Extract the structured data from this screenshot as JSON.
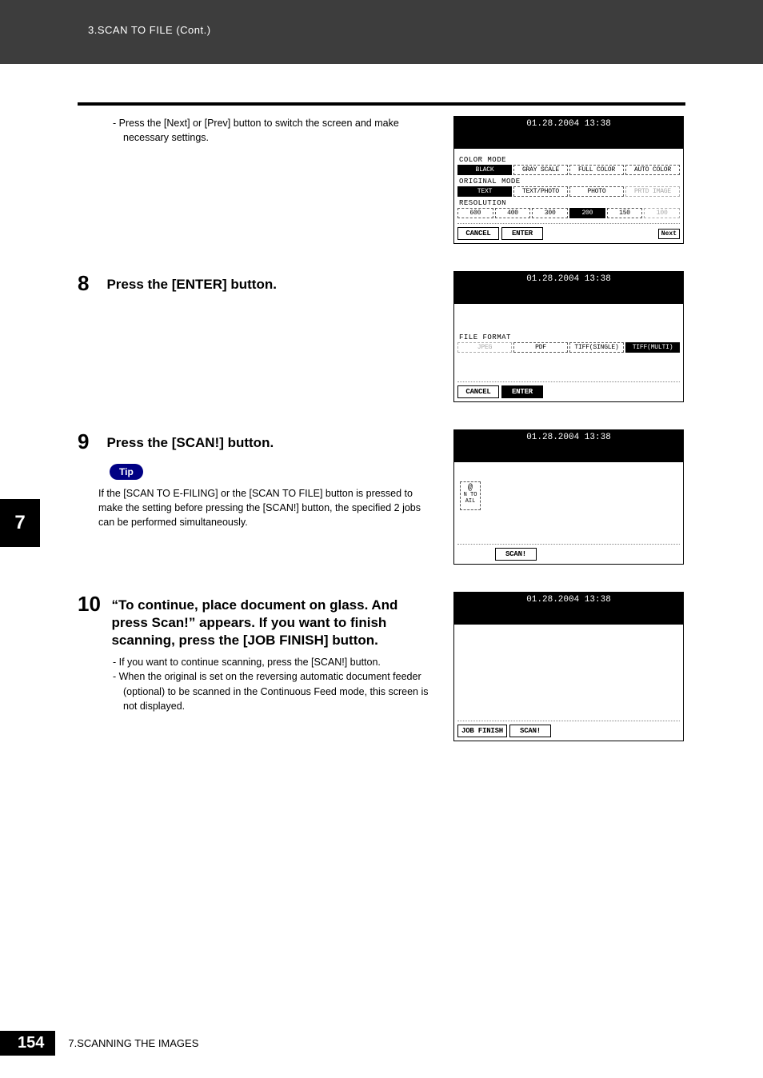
{
  "header": {
    "breadcrumb": "3.SCAN TO FILE (Cont.)"
  },
  "side_tab": "7",
  "footer": {
    "page": "154",
    "chapter": "7.SCANNING THE IMAGES"
  },
  "top_bullets": [
    "-  Press the [Next] or [Prev] button to switch the screen and make necessary settings."
  ],
  "steps": [
    {
      "num": "8",
      "title": "Press the [ENTER] button."
    },
    {
      "num": "9",
      "title": "Press the [SCAN!] button.",
      "tip_label": "Tip",
      "tip_text": "If the [SCAN TO E-FILING] or the [SCAN TO FILE] button is pressed to make the setting before pressing the [SCAN!] button, the specified 2 jobs can be performed simultaneously."
    },
    {
      "num": "10",
      "title": "“To continue, place document on glass. And press Scan!” appears. If you want to finish scanning, press the [JOB FINISH] button.",
      "bullets": [
        "-  If you want to continue scanning, press the [SCAN!] button.",
        "-  When the original is set on the reversing automatic document feeder (optional) to be scanned in the Continuous Feed mode, this screen is not displayed."
      ]
    }
  ],
  "screens": {
    "timestamp": "01.28.2004 13:38",
    "s1": {
      "color_mode_label": "COLOR MODE",
      "color_mode": {
        "opts": [
          "BLACK",
          "GRAY SCALE",
          "FULL COLOR",
          "AUTO COLOR"
        ],
        "selected": 0
      },
      "original_mode_label": "ORIGINAL MODE",
      "original_mode": {
        "opts": [
          "TEXT",
          "TEXT/PHOTO",
          "PHOTO",
          "PRTD IMAGE"
        ],
        "selected": 0,
        "disabled": [
          3
        ]
      },
      "resolution_label": "RESOLUTION",
      "resolution": {
        "opts": [
          "600",
          "400",
          "300",
          "200",
          "150",
          "100"
        ],
        "selected": 3,
        "disabled": [
          5
        ]
      },
      "cancel": "CANCEL",
      "enter": "ENTER",
      "next": "Next"
    },
    "s2": {
      "file_format_label": "FILE FORMAT",
      "file_format": {
        "opts": [
          "JPEG",
          "PDF",
          "TIFF(SINGLE)",
          "TIFF(MULTI)"
        ],
        "selected": 3,
        "disabled": [
          0
        ]
      },
      "cancel": "CANCEL",
      "enter": "ENTER"
    },
    "s3": {
      "icon_caption": "N TO\nAIL",
      "scan": "SCAN!"
    },
    "s4": {
      "jobfinish": "JOB FINISH",
      "scan": "SCAN!"
    }
  }
}
